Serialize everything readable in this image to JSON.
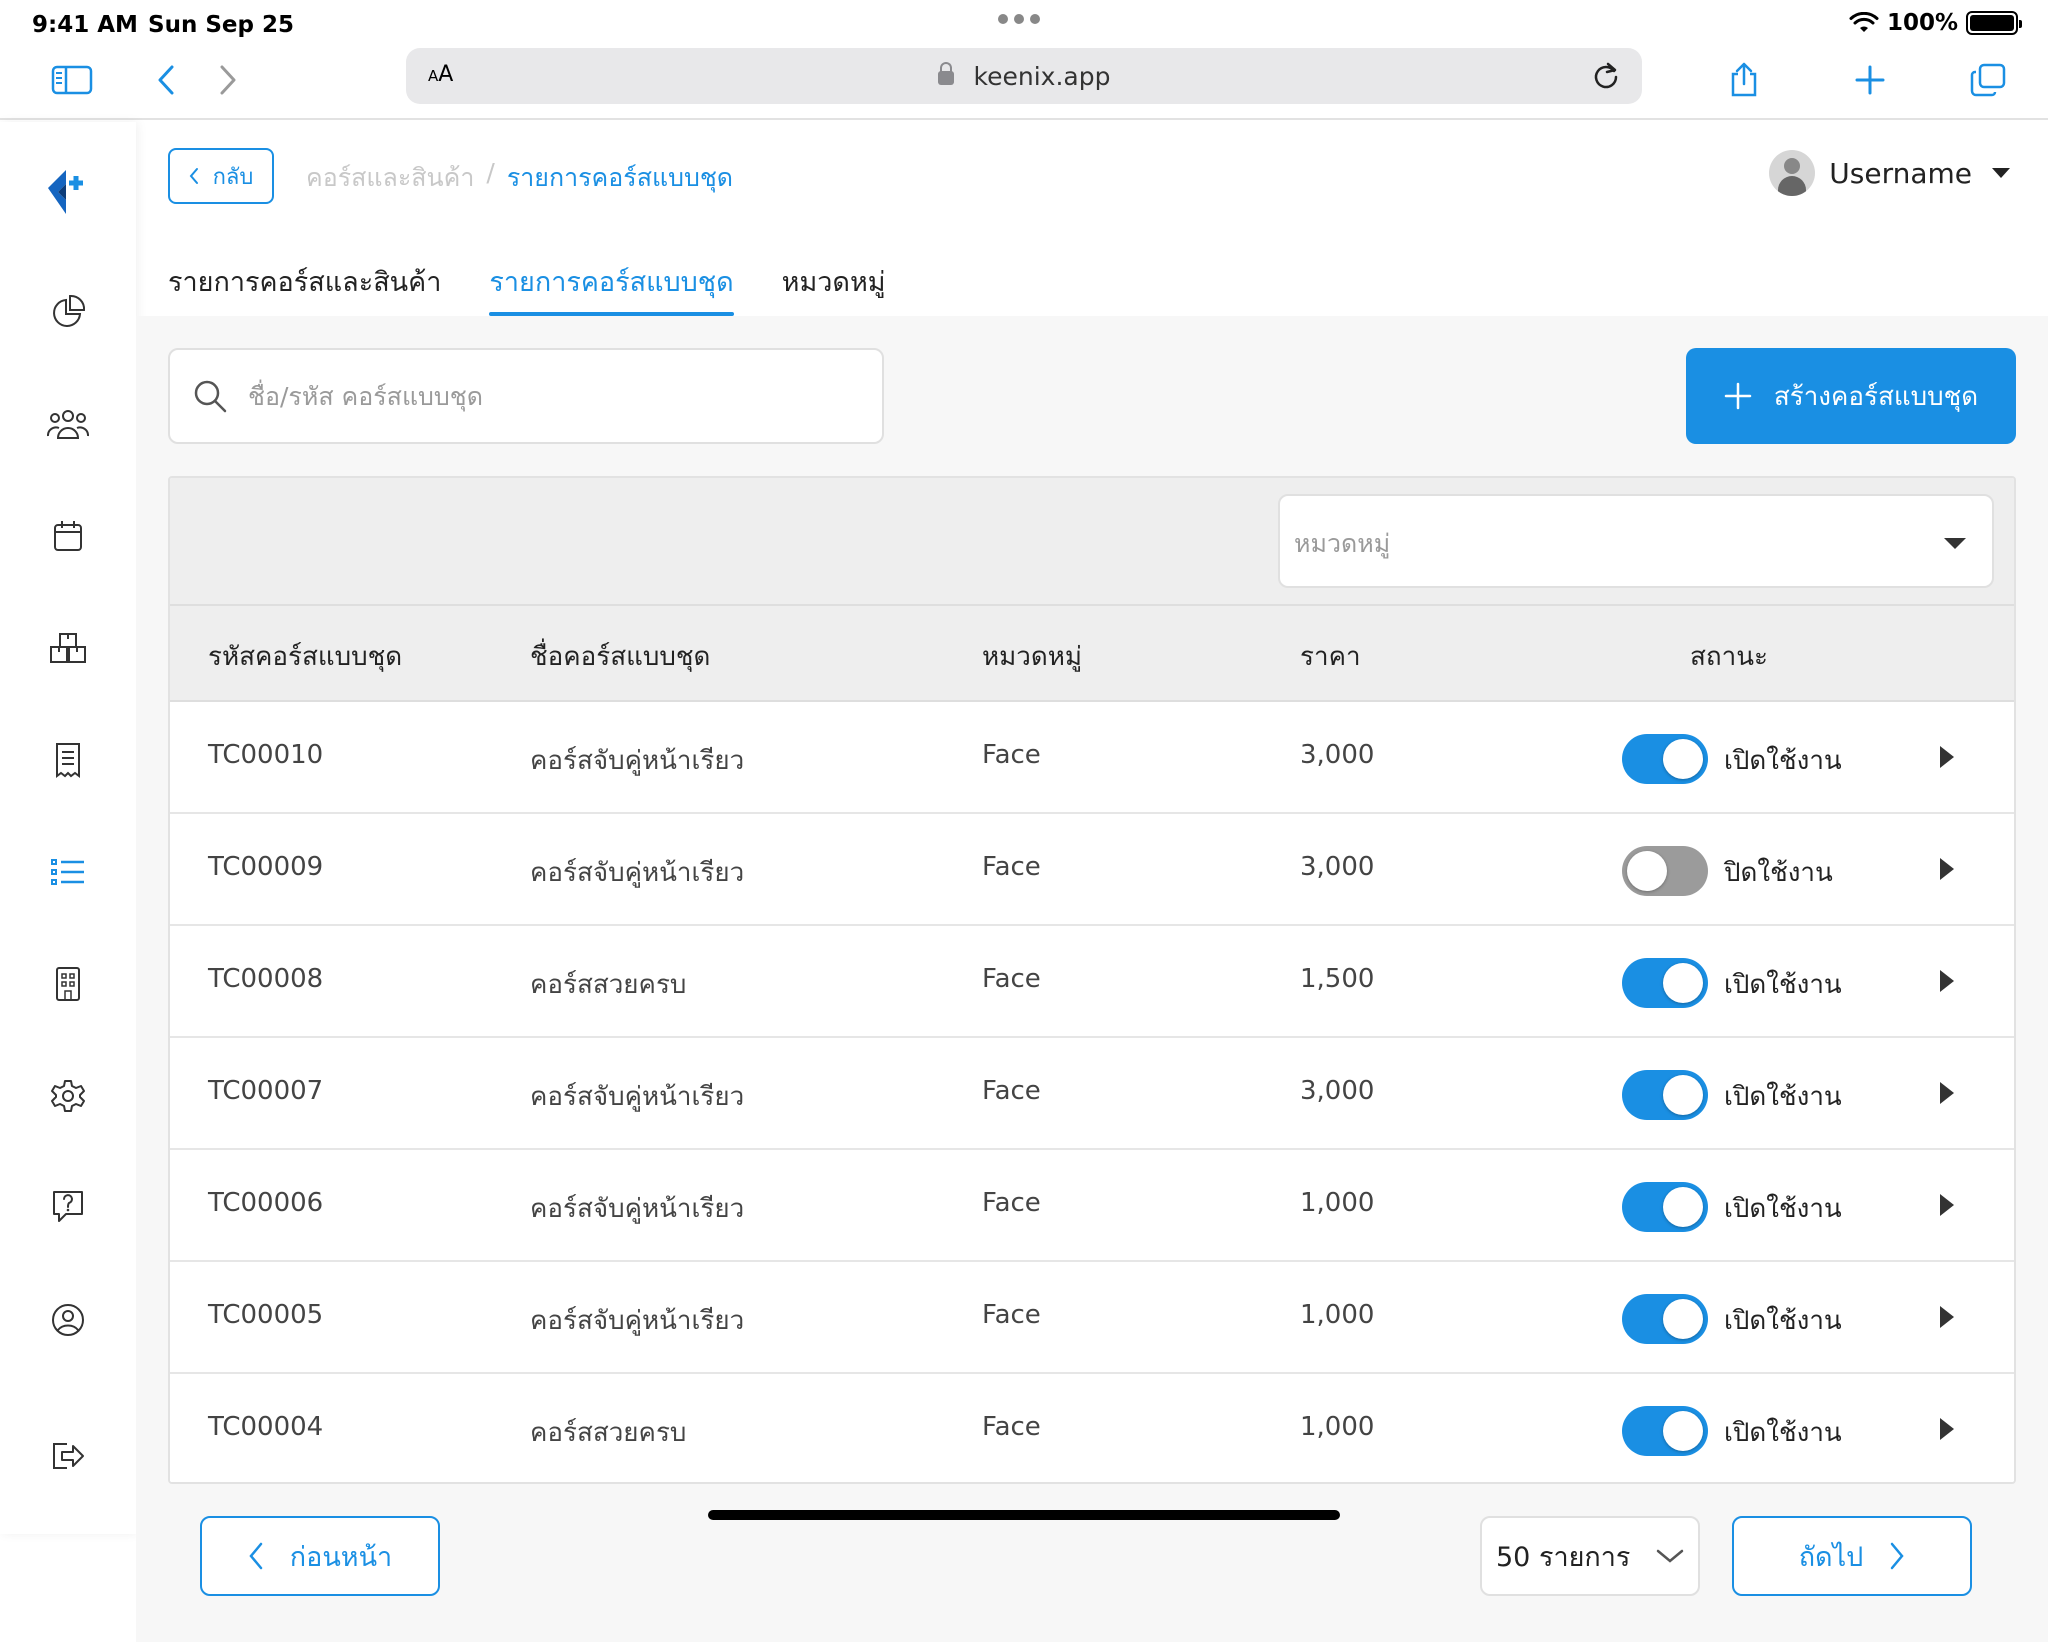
{
  "status_bar": {
    "time": "9:41 AM",
    "date": "Sun Sep 25",
    "battery": "100%"
  },
  "browser": {
    "url": "keenix.app",
    "text_size": "AA"
  },
  "sidebar": {
    "items": [
      {
        "icon": "logo-icon"
      },
      {
        "icon": "dashboard-chart-icon"
      },
      {
        "icon": "users-icon"
      },
      {
        "icon": "calendar-icon"
      },
      {
        "icon": "boxes-icon"
      },
      {
        "icon": "receipt-icon"
      },
      {
        "icon": "list-icon",
        "active": true
      },
      {
        "icon": "building-icon"
      },
      {
        "icon": "settings-icon"
      },
      {
        "icon": "help-icon"
      },
      {
        "icon": "profile-icon"
      },
      {
        "icon": "logout-icon"
      }
    ]
  },
  "header": {
    "back_label": "กลับ",
    "breadcrumb_parent": "คอร์สและสินค้า",
    "breadcrumb_sep": "/",
    "breadcrumb_current": "รายการคอร์สแบบชุด",
    "username": "Username"
  },
  "tabs": [
    {
      "label": "รายการคอร์สและสินค้า",
      "active": false
    },
    {
      "label": "รายการคอร์สแบบชุด",
      "active": true
    },
    {
      "label": "หมวดหมู่",
      "active": false
    }
  ],
  "search": {
    "placeholder": "ชื่อ/รหัส คอร์สแบบชุด",
    "value": ""
  },
  "create_button": {
    "label": "สร้างคอร์สแบบชุด"
  },
  "filter": {
    "category_placeholder": "หมวดหมู่"
  },
  "table": {
    "columns": [
      "รหัสคอร์สแบบชุด",
      "ชื่อคอร์สแบบชุด",
      "หมวดหมู่",
      "ราคา",
      "สถานะ"
    ],
    "rows": [
      {
        "code": "TC00010",
        "name": "คอร์สจับคู่หน้าเรียว",
        "category": "Face",
        "price": "3,000",
        "enabled": true,
        "status": "เปิดใช้งาน"
      },
      {
        "code": "TC00009",
        "name": "คอร์สจับคู่หน้าเรียว",
        "category": "Face",
        "price": "3,000",
        "enabled": false,
        "status": "ปิดใช้งาน"
      },
      {
        "code": "TC00008",
        "name": "คอร์สสวยครบ",
        "category": "Face",
        "price": "1,500",
        "enabled": true,
        "status": "เปิดใช้งาน"
      },
      {
        "code": "TC00007",
        "name": "คอร์สจับคู่หน้าเรียว",
        "category": "Face",
        "price": "3,000",
        "enabled": true,
        "status": "เปิดใช้งาน"
      },
      {
        "code": "TC00006",
        "name": "คอร์สจับคู่หน้าเรียว",
        "category": "Face",
        "price": "1,000",
        "enabled": true,
        "status": "เปิดใช้งาน"
      },
      {
        "code": "TC00005",
        "name": "คอร์สจับคู่หน้าเรียว",
        "category": "Face",
        "price": "1,000",
        "enabled": true,
        "status": "เปิดใช้งาน"
      },
      {
        "code": "TC00004",
        "name": "คอร์สสวยครบ",
        "category": "Face",
        "price": "1,000",
        "enabled": true,
        "status": "เปิดใช้งาน"
      }
    ]
  },
  "pagination": {
    "prev_label": "ก่อนหน้า",
    "next_label": "ถัดไป",
    "per_page": "50 รายการ"
  },
  "colors": {
    "accent": "#1a8fe3",
    "toggle_off": "#9b9b9b",
    "header_bg": "#eeeeee"
  }
}
